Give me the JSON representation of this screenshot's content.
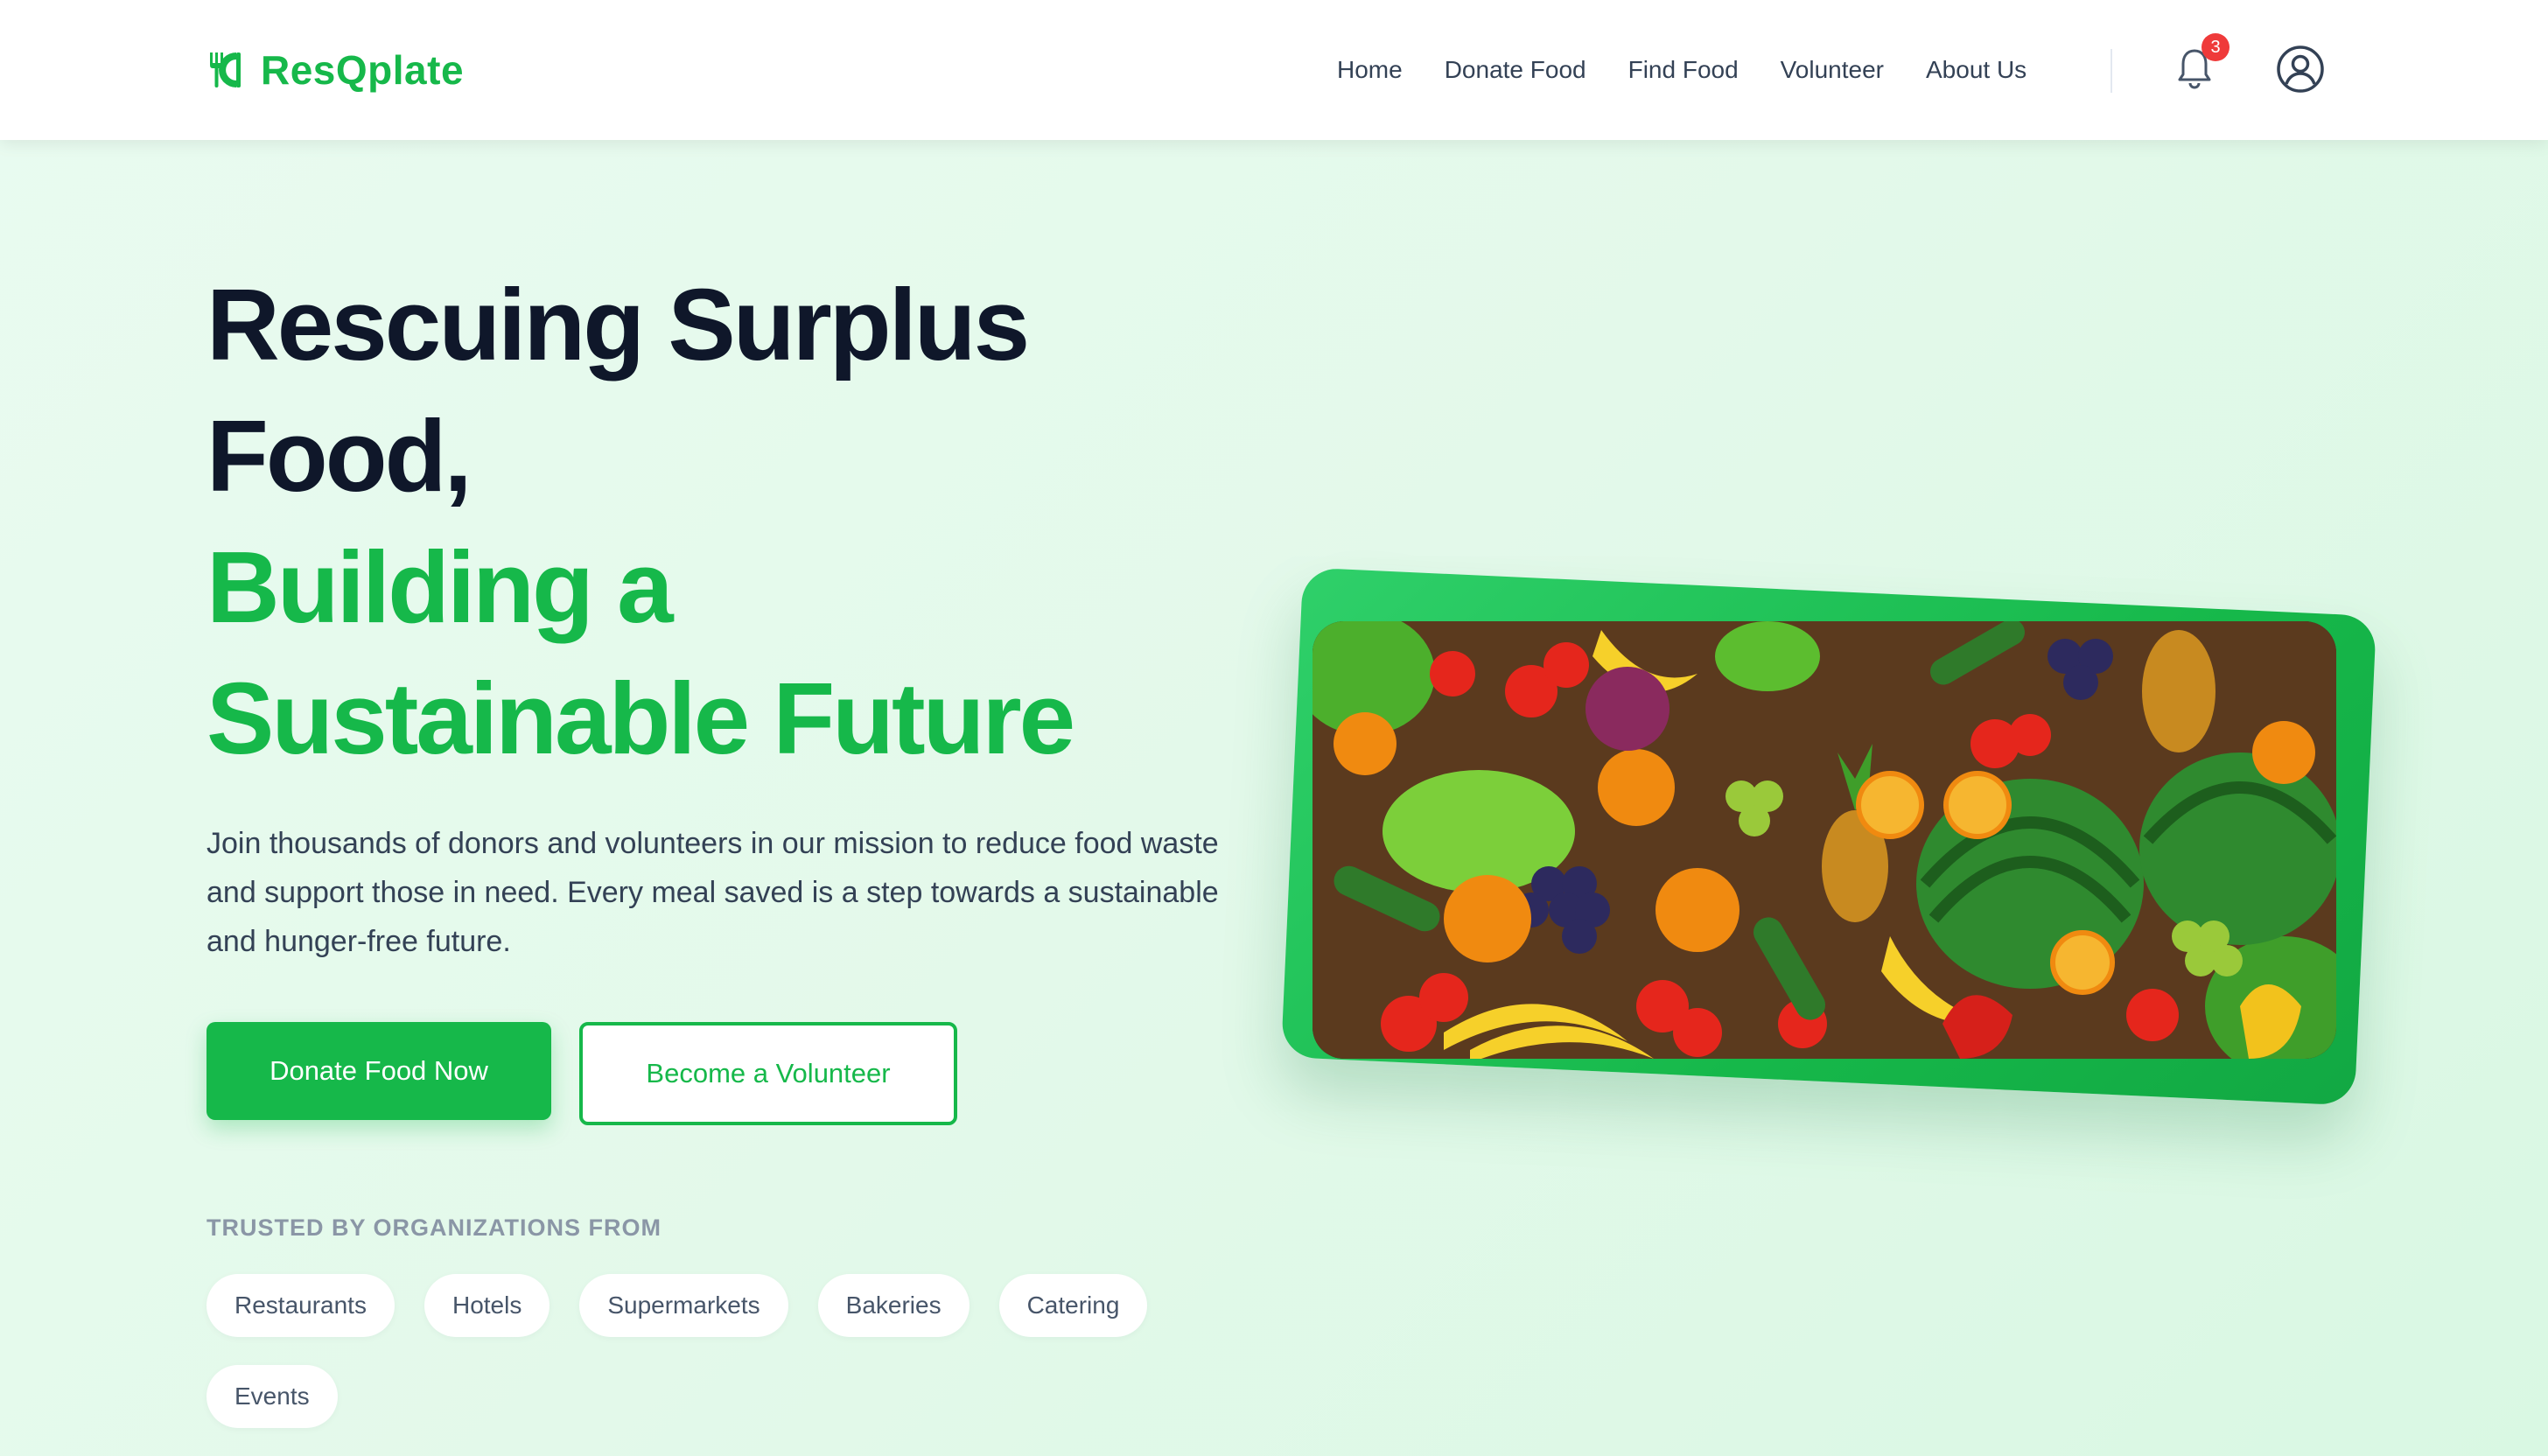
{
  "header": {
    "logo_text": "ResQplate",
    "logo_icon": "utensils-icon",
    "nav": [
      "Home",
      "Donate Food",
      "Find Food",
      "Volunteer",
      "About Us"
    ],
    "notification_count": "3",
    "notification_icon": "bell-icon",
    "profile_icon": "user-circle-icon"
  },
  "hero": {
    "title_line1": "Rescuing Surplus",
    "title_line2": "Food,",
    "title_line3": "Building a",
    "title_line4": "Sustainable Future",
    "description": "Join thousands of donors and volunteers in our mission to reduce food waste and support those in need. Every meal saved is a step towards a sustainable and hunger-free future.",
    "primary_button": "Donate Food Now",
    "secondary_button": "Become a Volunteer",
    "trusted_label": "TRUSTED BY ORGANIZATIONS FROM",
    "chips": [
      "Restaurants",
      "Hotels",
      "Supermarkets",
      "Bakeries",
      "Catering",
      "Events"
    ]
  },
  "colors": {
    "brand_green": "#16b84a",
    "heading_dark": "#0f172a",
    "badge_red": "#ef3a3a"
  }
}
